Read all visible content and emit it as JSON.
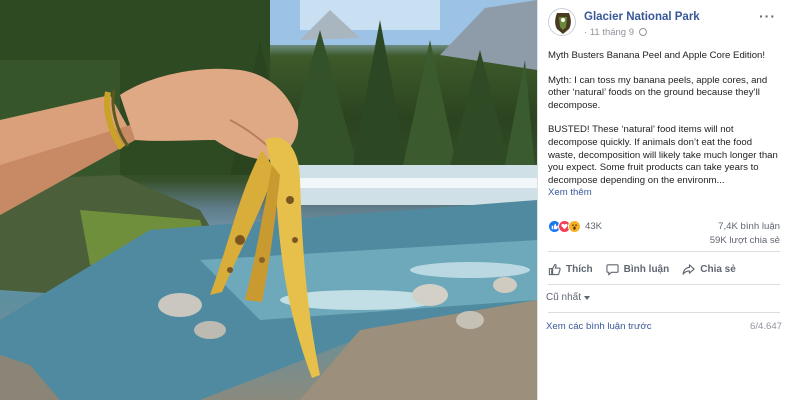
{
  "post": {
    "page_name": "Glacier National Park",
    "date": "11 tháng 9",
    "more_icon": "···",
    "paragraphs": [
      "Myth Busters Banana Peel and Apple Core Edition!",
      "Myth: I can toss my banana peels, apple cores, and other ‘natural’ foods on the ground because they’ll decompose.",
      "BUSTED! These ‘natural’ food items will not decompose quickly. If animals don’t eat the food waste, decomposition will likely take much longer than you expect. Some fruit products can take years to decompose depending on the environm..."
    ],
    "see_more": "Xem thêm"
  },
  "stats": {
    "reaction_count": "43K",
    "comments": "7,4K bình luận",
    "shares": "59K lượt chia sẻ"
  },
  "actions": {
    "like": "Thích",
    "comment": "Bình luận",
    "share": "Chia sẻ"
  },
  "comments": {
    "sort_label": "Cũ nhất",
    "view_previous": "Xem các bình luận trước",
    "pager": "6/4.647"
  },
  "icons": {
    "reactions": [
      "like-icon",
      "love-icon",
      "wow-icon"
    ],
    "actions": [
      "thumbs-up-icon",
      "speech-bubble-icon",
      "share-arrow-icon"
    ]
  },
  "colors": {
    "link": "#385898",
    "muted": "#606770",
    "like": "#1877f2",
    "love": "#f33e58",
    "wow": "#f7b125"
  }
}
